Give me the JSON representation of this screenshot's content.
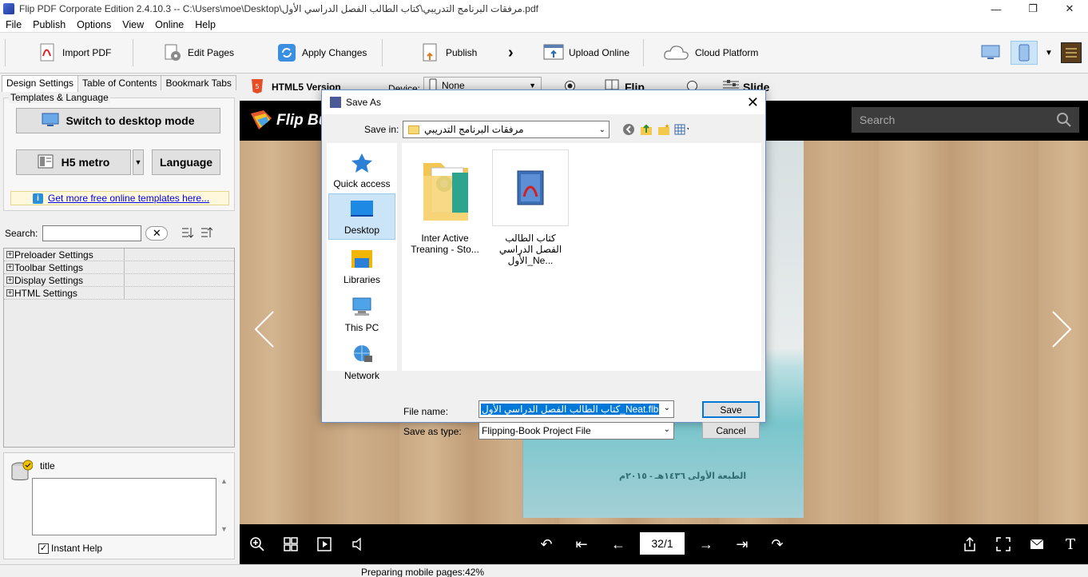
{
  "window": {
    "title": "Flip PDF Corporate Edition 2.4.10.3 -- C:\\Users\\moe\\Desktop\\مرفقات البرنامج التدريبي\\كتاب الطالب الفصل الدراسي الأول.pdf",
    "min": "—",
    "max": "❐",
    "close": "✕"
  },
  "menu": [
    "File",
    "Publish",
    "Options",
    "View",
    "Online",
    "Help"
  ],
  "toolbar": {
    "import_pdf": "Import PDF",
    "edit_pages": "Edit Pages",
    "apply_changes": "Apply Changes",
    "publish": "Publish",
    "upload_online": "Upload Online",
    "cloud_platform": "Cloud Platform"
  },
  "left": {
    "tabs": [
      "Design Settings",
      "Table of Contents",
      "Bookmark Tabs"
    ],
    "group_title": "Templates & Language",
    "switch_btn": "Switch to desktop mode",
    "template_btn": "H5 metro",
    "language_btn": "Language",
    "more_link": "Get more free online templates here...",
    "search_label": "Search:",
    "settings": [
      "Preloader Settings",
      "Toolbar Settings",
      "Display Settings",
      "HTML Settings"
    ],
    "title_label": "title",
    "instant_help": "Instant Help"
  },
  "main": {
    "version": "HTML5 Version",
    "device_label": "Device:",
    "device_value": "None",
    "mode_flip": "Flip",
    "mode_slide": "Slide",
    "brand": "Flip Bu",
    "search_placeholder": "Search",
    "page_indicator": "32/1",
    "cover_text": "الطبعة الأولى ١٤٣٦هـ - ٢٠١٥م"
  },
  "status": "Preparing mobile pages:42%",
  "dialog": {
    "title": "Save As",
    "save_in_label": "Save in:",
    "save_in_value": "مرفقات البرنامج التدريبي",
    "places": [
      "Quick access",
      "Desktop",
      "Libraries",
      "This PC",
      "Network"
    ],
    "files": [
      {
        "name": "Inter Active Treaning - Sto..."
      },
      {
        "name": "كتاب الطالب الفصل الدراسي الأول_Ne..."
      }
    ],
    "file_name_label": "File name:",
    "file_name_value": "كتاب الطالب الفصل الدراسي الأول_Neat.flb",
    "save_type_label": "Save as type:",
    "save_type_value": "Flipping-Book Project File",
    "save_btn": "Save",
    "cancel_btn": "Cancel"
  }
}
